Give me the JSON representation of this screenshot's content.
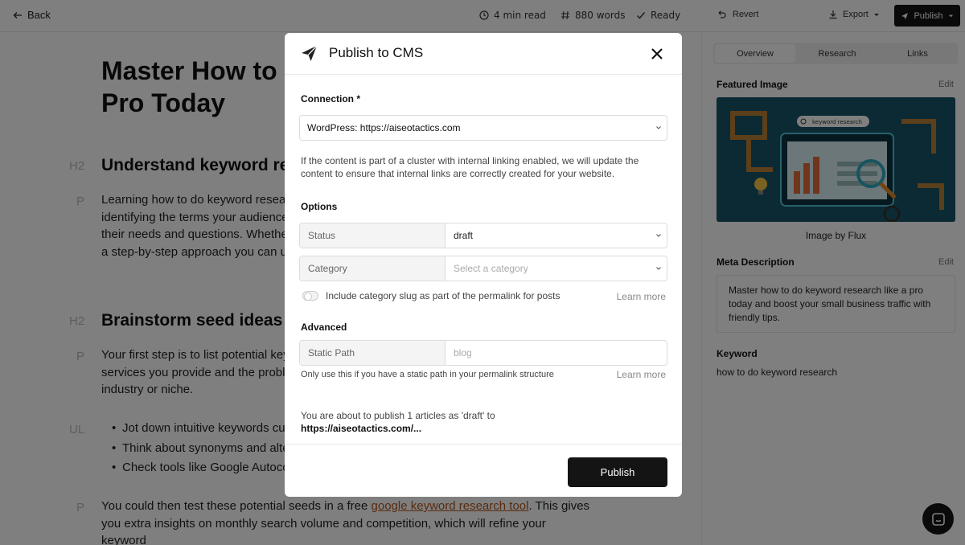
{
  "topbar": {
    "back_label": "Back",
    "read_time": "4 min read",
    "word_count": "880 words",
    "status": "Ready",
    "revert_label": "Revert",
    "export_label": "Export",
    "publish_label": "Publish"
  },
  "editor": {
    "title": "Master How to Do Keyword Research Like a Pro Today",
    "sections": [
      {
        "tag": "H2",
        "heading": "Understand keyword research",
        "tag_p": "P",
        "paragraph": "Learning how to do keyword research can help you grow your small business online. By identifying the terms your audience uses, you can create content that directly addresses their needs and questions. Whether you are new to SEO or simply want a refresher, here is a step-by-step approach you can use right away."
      },
      {
        "tag": "H2",
        "heading": "Brainstorm seed ideas",
        "tag_p": "P",
        "paragraph": "Your first step is to list potential keywords related to your business. Think of any products or services you provide and the problems you solve. Also include terms that describe your industry or niche."
      }
    ],
    "tag_ul": "UL",
    "bullets": [
      "Jot down intuitive keywords customers might use",
      "Think about synonyms and alternate phrasing",
      "Check tools like Google Autocomplete for suggestions"
    ],
    "tag_p3": "P",
    "para3_before": "You could then test these potential seeds in a free ",
    "para3_link": "google keyword research tool",
    "para3_after": ". This gives you extra insights on monthly search volume and competition, which will refine your keyword"
  },
  "sidebar": {
    "tabs": [
      "Overview",
      "Research",
      "Links"
    ],
    "active_tab": "Overview",
    "featured_image_label": "Featured Image",
    "featured_image_edit": "Edit",
    "image_caption": "Image by Flux",
    "image_text": "keyword research",
    "meta_label": "Meta Description",
    "meta_edit": "Edit",
    "meta_text": "Master how to do keyword research like a pro today and boost your small business traffic with friendly tips.",
    "keyword_label": "Keyword",
    "keyword_value": "how to do keyword research"
  },
  "modal": {
    "title": "Publish to CMS",
    "connection_label": "Connection *",
    "connection_value": "WordPress: https://aiseotactics.com",
    "connection_help": "If the content is part of a cluster with internal linking enabled, we will update the content to ensure that internal links are correctly created for your website.",
    "options_label": "Options",
    "status_key": "Status",
    "status_value": "draft",
    "category_key": "Category",
    "category_placeholder": "Select a category",
    "toggle_label": "Include category slug as part of the permalink for posts",
    "learn_more": "Learn more",
    "advanced_label": "Advanced",
    "static_path_key": "Static Path",
    "static_path_placeholder": "blog",
    "static_path_help": "Only use this if you have a static path in your permalink structure",
    "summary_text": "You are about to publish 1 articles as 'draft' to",
    "summary_url": "https://aiseotactics.com/...",
    "publish_button": "Publish"
  }
}
